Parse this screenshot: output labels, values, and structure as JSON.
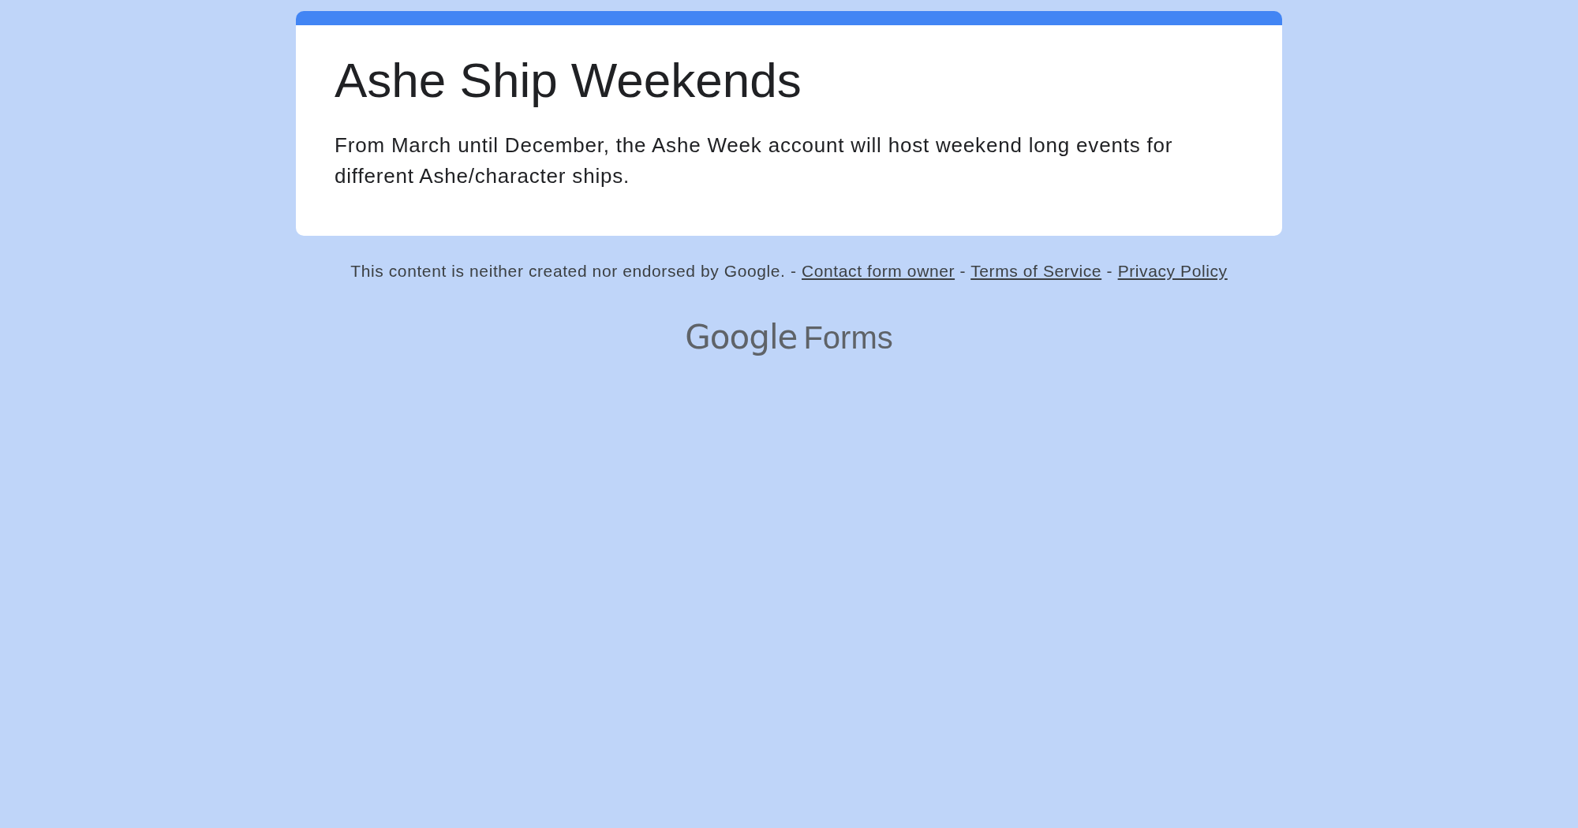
{
  "form_header": {
    "title": "Ashe Ship Weekends",
    "description": "From March until December, the Ashe Week account will host weekend long events for different Ashe/character ships."
  },
  "footer": {
    "parts": [
      {
        "kind": "text",
        "text": "This content is neither created nor endorsed by Google. -"
      },
      {
        "kind": "link",
        "text": "Contact form owner"
      },
      {
        "kind": "text",
        "text": "-"
      },
      {
        "kind": "link",
        "text": "Terms of Service"
      },
      {
        "kind": "text",
        "text": "-"
      },
      {
        "kind": "link",
        "text": "Privacy Policy"
      }
    ]
  },
  "logo": {
    "brand": "Google",
    "product": "Forms"
  }
}
